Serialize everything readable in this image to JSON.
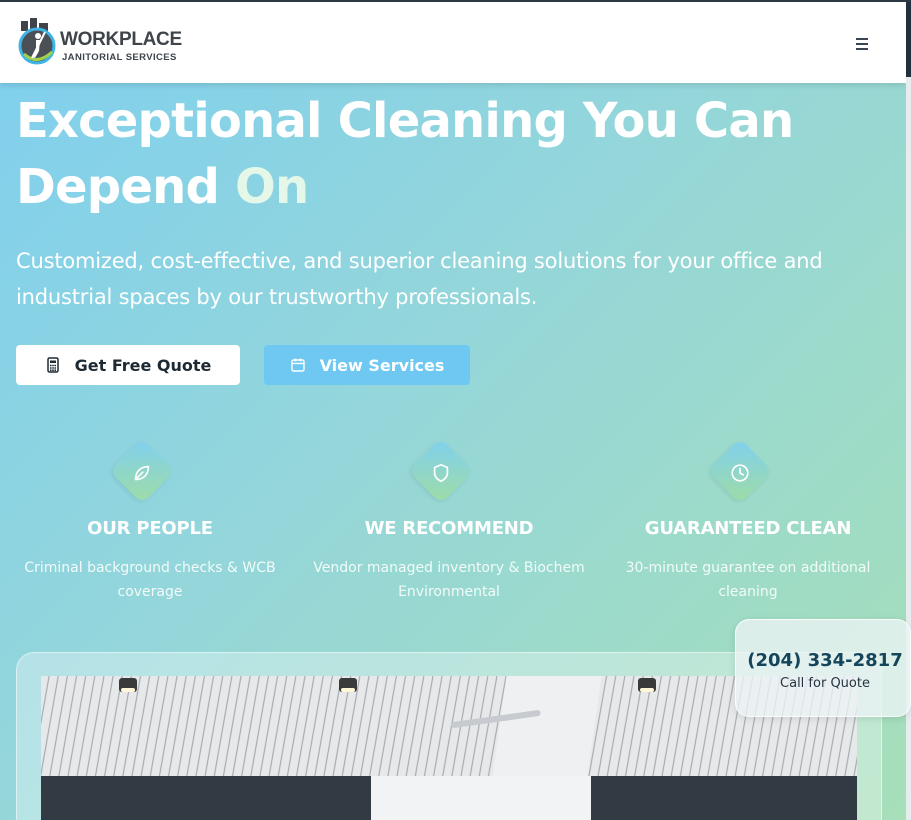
{
  "header": {
    "logo_word": "WORKPLACE",
    "logo_sub": "JANITORIAL SERVICES",
    "menu_icon": "hamburger-menu-icon"
  },
  "hero": {
    "title_main": "Exceptional Cleaning You Can Depend ",
    "title_accent": "On",
    "subtitle": "Customized, cost-effective, and superior cleaning solutions for your office and industrial spaces by our trustworthy professionals."
  },
  "buttons": {
    "quote_label": "Get Free Quote",
    "quote_icon": "calculator-icon",
    "services_label": "View Services",
    "services_icon": "calendar-icon"
  },
  "features": [
    {
      "icon": "leaf-icon",
      "title": "OUR PEOPLE",
      "desc": "Criminal background checks & WCB coverage"
    },
    {
      "icon": "shield-icon",
      "title": "WE RECOMMEND",
      "desc": "Vendor managed inventory & Biochem Environmental"
    },
    {
      "icon": "clock-icon",
      "title": "GUARANTEED CLEAN",
      "desc": "30-minute guarantee on additional cleaning"
    }
  ],
  "call_card": {
    "phone": "(204) 334-2817",
    "label": "Call for Quote"
  },
  "colors": {
    "gradient_start": "#7ecfef",
    "gradient_end": "#a6dfb8",
    "services_button": "#6ec8f2",
    "phone_text": "#15455a"
  }
}
